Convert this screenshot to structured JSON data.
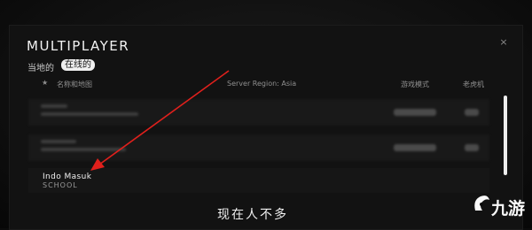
{
  "window": {
    "title": "MULTIPLAYER",
    "close_glyph": "×"
  },
  "tabs": [
    {
      "label": "当地的",
      "active": false
    },
    {
      "label": "在线的",
      "active": true
    }
  ],
  "table": {
    "headers": {
      "favorite_icon": "star-icon",
      "name": "名称和地图",
      "region": "Server Region: Asia",
      "mode": "游戏模式",
      "slots": "老虎机"
    },
    "rows": [
      {
        "name": "Indo Masuk",
        "mode": "SCHOOL"
      }
    ]
  },
  "caption": "现在人不多",
  "watermark": {
    "text": "九游"
  },
  "colors": {
    "arrow": "#e0201c",
    "active_tab_bg": "#f0f0f0",
    "background": "#121212"
  }
}
